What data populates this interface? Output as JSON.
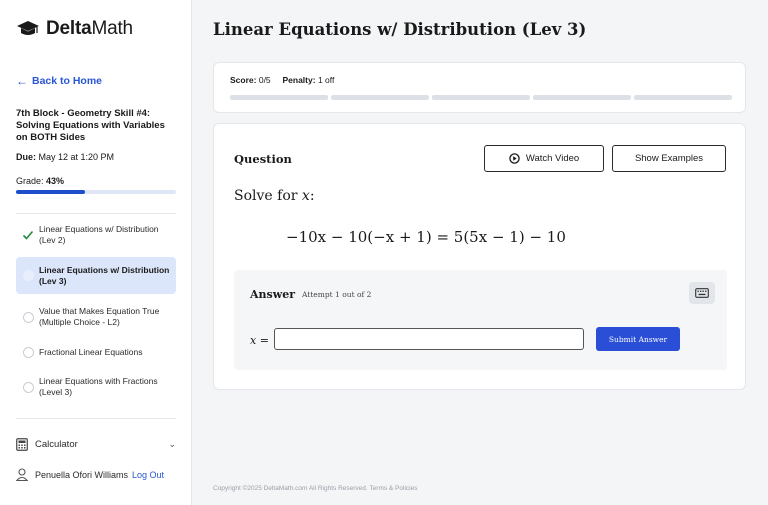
{
  "brand": {
    "name_bold": "Delta",
    "name_rest": "Math"
  },
  "sidebar": {
    "back_label": "Back to Home",
    "assignment_title": "7th Block - Geometry Skill #4: Solving Equations with Variables on BOTH Sides",
    "due_label": "Due:",
    "due_value": "May 12 at 1:20 PM",
    "grade_label": "Grade:",
    "grade_value": "43%",
    "grade_fraction": 0.43,
    "skills": [
      {
        "label": "Linear Equations w/ Distribution (Lev 2)",
        "state": "complete"
      },
      {
        "label": "Linear Equations w/ Distribution (Lev 3)",
        "state": "active"
      },
      {
        "label": "Value that Makes Equation True (Multiple Choice - L2)",
        "state": "todo"
      },
      {
        "label": "Fractional Linear Equations",
        "state": "todo"
      },
      {
        "label": "Linear Equations with Fractions (Level 3)",
        "state": "todo"
      }
    ],
    "calculator_label": "Calculator",
    "user_name": "Penuella Ofori Williams",
    "logout_label": "Log Out"
  },
  "main": {
    "title": "Linear Equations w/ Distribution (Lev 3)",
    "score_label": "Score:",
    "score_value": "0/5",
    "penalty_label": "Penalty:",
    "penalty_value": "1 off",
    "progress_segments": 5,
    "question_label": "Question",
    "watch_video_label": "Watch Video",
    "show_examples_label": "Show Examples",
    "solve_prefix": "Solve for",
    "solve_var": "x",
    "solve_suffix": ":",
    "equation": "−10x − 10(−x + 1) = 5(5x − 1) − 10",
    "answer_label": "Answer",
    "attempt_text": "Attempt 1 out of 2",
    "answer_var": "x",
    "answer_eq": "=",
    "answer_value": "",
    "submit_label": "Submit Answer"
  },
  "footer": {
    "text": "Copyright ©2025 DeltaMath.com All Rights Reserved. Terms & Policies"
  },
  "colors": {
    "accent": "#2a4fd6",
    "link": "#2a56d6",
    "active_bg": "#dce6fb",
    "check": "#1e8a3c"
  }
}
